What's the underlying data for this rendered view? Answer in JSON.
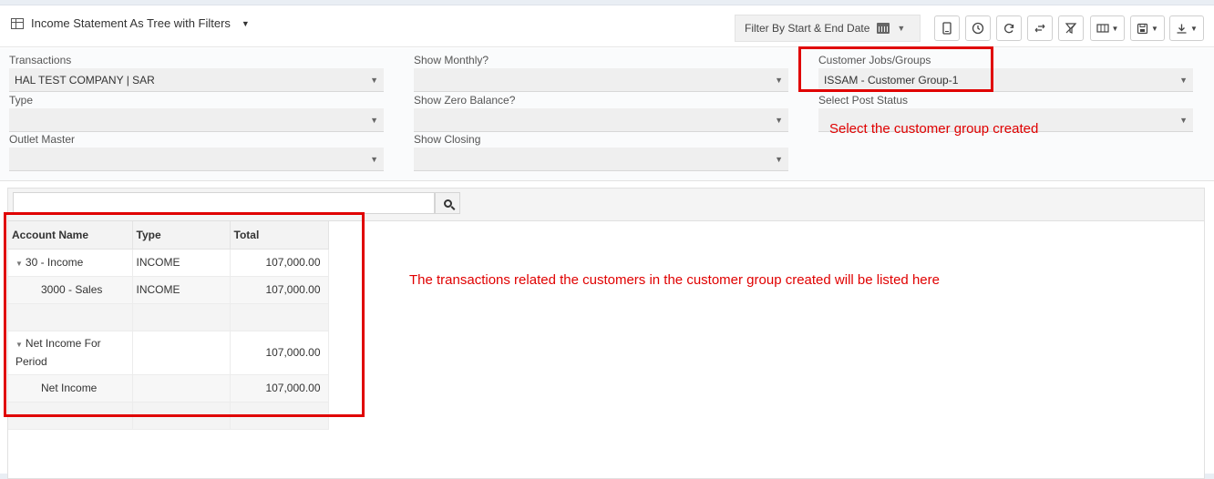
{
  "header": {
    "title": "Income Statement As Tree with Filters",
    "date_filter_label": "Filter By Start & End Date"
  },
  "filters": {
    "transactions_label": "Transactions",
    "transactions_value": "HAL TEST COMPANY | SAR",
    "type_label": "Type",
    "type_value": "",
    "outlet_label": "Outlet Master",
    "outlet_value": "",
    "show_monthly_label": "Show Monthly?",
    "show_monthly_value": "",
    "show_zero_label": "Show Zero Balance?",
    "show_zero_value": "",
    "show_closing_label": "Show Closing",
    "show_closing_value": "",
    "customer_jobs_label": "Customer Jobs/Groups",
    "customer_jobs_value": "ISSAM - Customer Group-1",
    "post_status_label": "Select Post Status",
    "post_status_value": ""
  },
  "search": {
    "placeholder": "",
    "value": ""
  },
  "grid": {
    "headers": [
      "Account Name",
      "Type",
      "Total"
    ],
    "rows": [
      {
        "name": "30 - Income",
        "type": "INCOME",
        "total": "107,000.00"
      },
      {
        "name": "3000 - Sales",
        "type": "INCOME",
        "total": "107,000.00"
      },
      {
        "name": "",
        "type": "",
        "total": ""
      },
      {
        "name": "Net Income For Period",
        "type": "",
        "total": "107,000.00"
      },
      {
        "name": "Net Income",
        "type": "",
        "total": "107,000.00"
      },
      {
        "name": "",
        "type": "",
        "total": ""
      }
    ]
  },
  "annotations": {
    "customer_group_note": "Select the customer group created",
    "transactions_note": "The transactions related the customers in the customer group created will be listed here"
  },
  "colors": {
    "annotation_red": "#e00000",
    "panel_bg": "#fafbfc"
  },
  "icons": {
    "title": "table-icon",
    "calendar": "calendar-icon",
    "toolbar": [
      "mobile-icon",
      "clock-icon",
      "refresh-icon",
      "expand-arrows-icon",
      "clear-filter-icon",
      "columns-icon",
      "save-icon",
      "download-icon"
    ],
    "search": "search-icon"
  }
}
